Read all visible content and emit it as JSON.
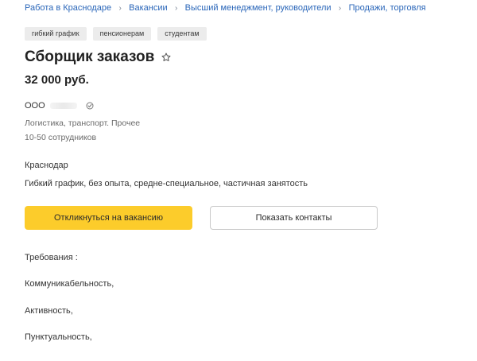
{
  "breadcrumb": {
    "items": [
      "Работа в Краснодаре",
      "Вакансии",
      "Высший менеджмент, руководители",
      "Продажи, торговля"
    ]
  },
  "tags": [
    "гибкий график",
    "пенсионерам",
    "студентам"
  ],
  "vacancy": {
    "title": "Сборщик заказов",
    "salary": "32 000 руб.",
    "star_icon": "star-outline-icon"
  },
  "company": {
    "name": "ООО",
    "verified_icon": "verified-icon",
    "industry": "Логистика, транспорт.  Прочее",
    "employees": "10-50 сотрудников"
  },
  "location": {
    "city": "Краснодар",
    "schedule": "Гибкий график, без опыта, средне-специальное, частичная занятость"
  },
  "actions": {
    "apply_label": "Откликнуться на вакансию",
    "contacts_label": "Показать контакты"
  },
  "description": {
    "lines": [
      "Требования :",
      "Коммуникабельность,",
      "Активность,",
      "Пунктуальность,"
    ]
  },
  "colors": {
    "link": "#2a66b9",
    "apply_button": "#fccc2b",
    "tag_bg": "#ececec"
  }
}
